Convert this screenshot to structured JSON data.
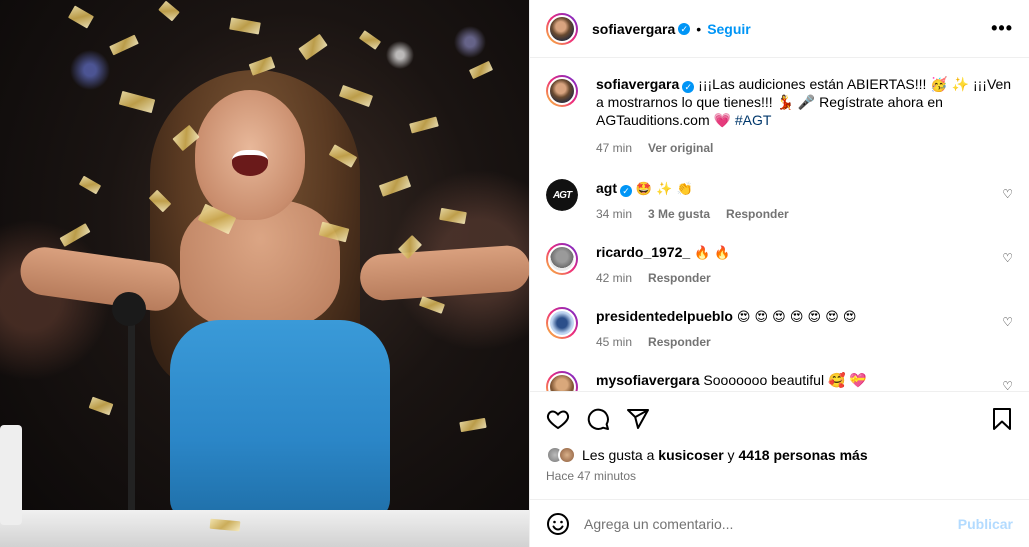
{
  "post": {
    "image_alt": "Sofía Vergara con vestido azul lanzando confeti dorado",
    "author": "sofiavergara",
    "follow_label": "Seguir",
    "more_icon": "more-horizontal-icon"
  },
  "caption": {
    "username": "sofiavergara",
    "text": "¡¡¡Las audiciones están ABIERTAS!!! 🥳 ✨ ¡¡¡Ven a mostrarnos lo que tienes!!! 💃 🎤 Regístrate ahora en AGTauditions.com 💗",
    "hashtag": "#AGT",
    "time": "47 min",
    "see_original": "Ver original"
  },
  "comments": [
    {
      "username": "agt",
      "verified": true,
      "text": "🤩 ✨ 👏",
      "time": "34 min",
      "likes": "3 Me gusta",
      "reply": "Responder"
    },
    {
      "username": "ricardo_1972_",
      "verified": false,
      "text": "🔥 🔥",
      "time": "42 min",
      "likes": "",
      "reply": "Responder"
    },
    {
      "username": "presidentedelpueblo",
      "verified": false,
      "text": "😍 😍 😍 😍 😍 😍 😍",
      "time": "45 min",
      "likes": "",
      "reply": "Responder"
    },
    {
      "username": "mysofiavergara",
      "verified": false,
      "text": "Sooooooo beautiful 🥰 💝",
      "time": "",
      "likes": "",
      "reply": ""
    }
  ],
  "actions": {
    "like_icon": "heart-icon",
    "comment_icon": "comment-icon",
    "share_icon": "share-icon",
    "save_icon": "bookmark-icon"
  },
  "likes": {
    "prefix": "Les gusta a",
    "user": "kusicoser",
    "connector": "y",
    "others": "4418 personas más"
  },
  "timestamp": "Hace 47 minutos",
  "add_comment": {
    "placeholder": "Agrega un comentario...",
    "publish": "Publicar",
    "emoji_icon": "emoji-icon"
  }
}
